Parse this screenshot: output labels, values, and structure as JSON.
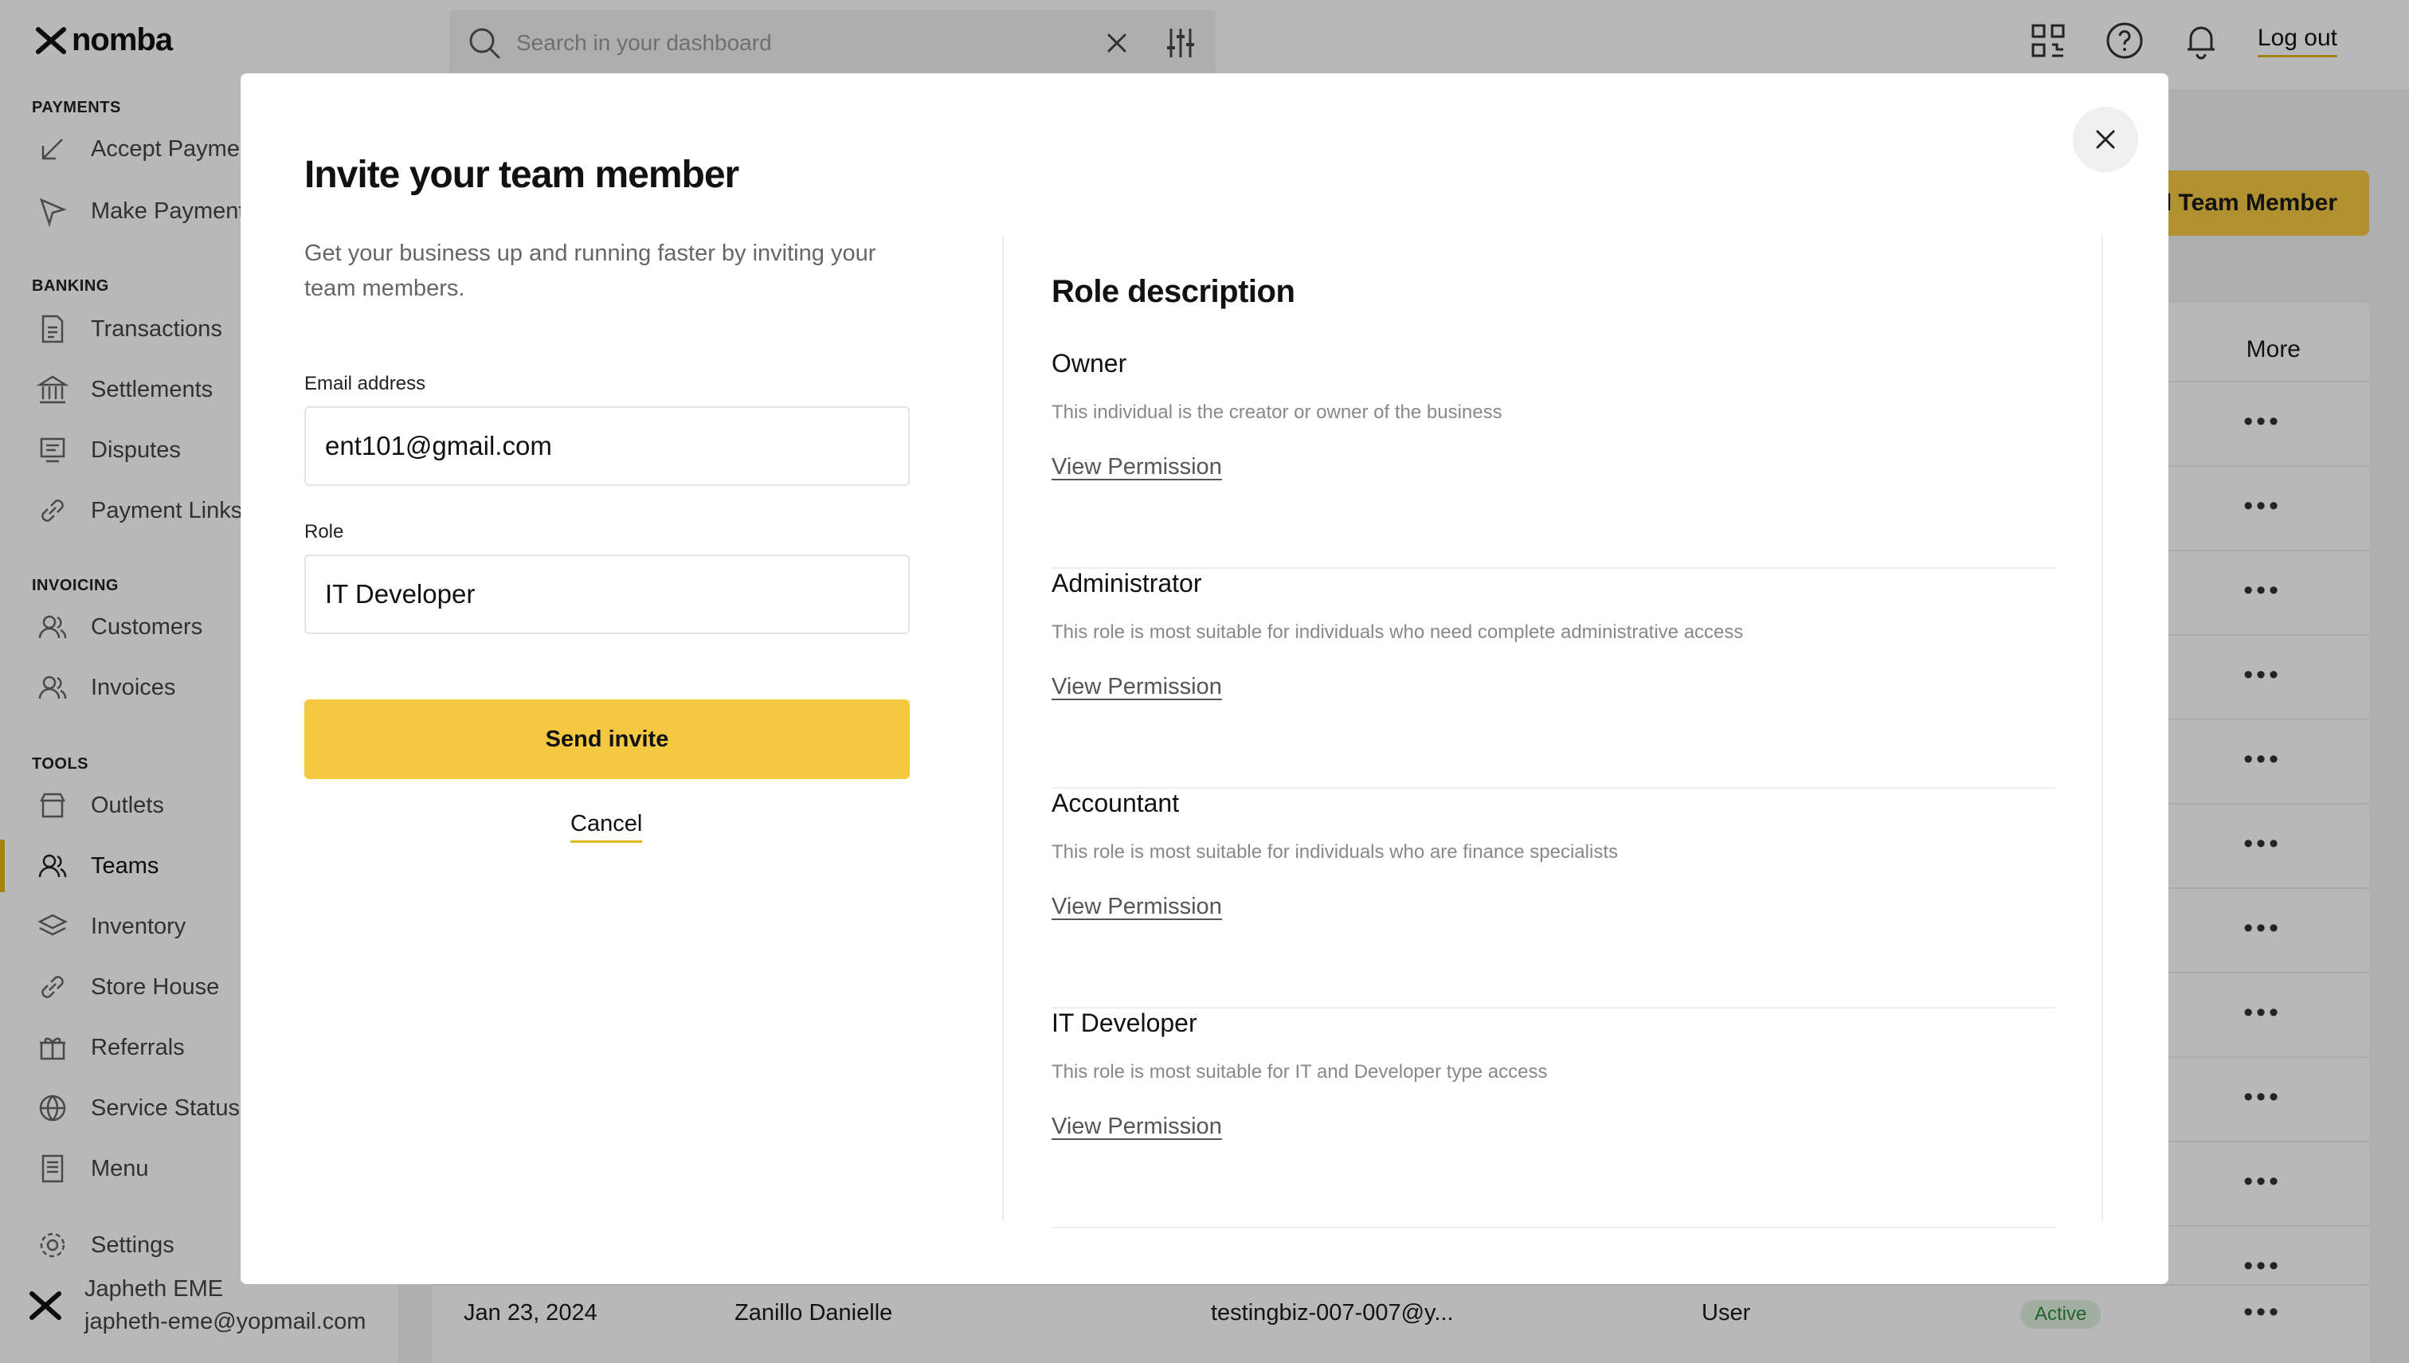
{
  "brand": {
    "name": "nomba",
    "accent": "#f5c842"
  },
  "search": {
    "placeholder": "Search in your dashboard"
  },
  "header": {
    "logout_label": "Log out"
  },
  "sidebar": {
    "sections": [
      {
        "title": "PAYMENTS"
      },
      {
        "title": "BANKING"
      },
      {
        "title": "INVOICING"
      },
      {
        "title": "TOOLS"
      }
    ],
    "items": [
      {
        "label": "Accept Payments",
        "icon": "arrow-down-left-icon"
      },
      {
        "label": "Make Payments",
        "icon": "send-icon"
      },
      {
        "label": "Transactions",
        "icon": "document-icon"
      },
      {
        "label": "Settlements",
        "icon": "bank-icon"
      },
      {
        "label": "Disputes",
        "icon": "monitor-icon"
      },
      {
        "label": "Payment Links",
        "icon": "link-icon"
      },
      {
        "label": "Customers",
        "icon": "users-icon"
      },
      {
        "label": "Invoices",
        "icon": "users-icon"
      },
      {
        "label": "Outlets",
        "icon": "store-icon"
      },
      {
        "label": "Teams",
        "icon": "users-icon"
      },
      {
        "label": "Inventory",
        "icon": "layers-icon"
      },
      {
        "label": "Store House",
        "icon": "link-icon"
      },
      {
        "label": "Referrals",
        "icon": "gift-icon"
      },
      {
        "label": "Service Status",
        "icon": "globe-icon"
      },
      {
        "label": "Menu",
        "icon": "list-icon"
      },
      {
        "label": "Settings",
        "icon": "gear-icon"
      }
    ],
    "user": {
      "name": "Japheth EME",
      "email": "japheth-eme@yopmail.com"
    }
  },
  "main": {
    "add_button_label": "Add Team Member",
    "table": {
      "more_header": "More",
      "last_row": {
        "date": "Jan 23, 2024",
        "name": "Zanillo Danielle",
        "email": "testingbiz-007-007@y...",
        "role": "User",
        "status": "Active"
      }
    }
  },
  "modal": {
    "title": "Invite your team member",
    "subtitle": "Get your business up and running faster by inviting your team members.",
    "email_label": "Email address",
    "email_value": "ent101@gmail.com",
    "role_label": "Role",
    "role_value": "IT Developer",
    "send_label": "Send invite",
    "cancel_label": "Cancel",
    "roles_title": "Role description",
    "view_permission_label": "View Permission",
    "roles": [
      {
        "name": "Owner",
        "description": "This individual is the creator or owner of the business"
      },
      {
        "name": "Administrator",
        "description": "This role is most suitable for individuals who need complete administrative access"
      },
      {
        "name": "Accountant",
        "description": "This role is most suitable for individuals who are finance specialists"
      },
      {
        "name": "IT Developer",
        "description": "This role is most suitable for IT and Developer type access"
      }
    ]
  }
}
